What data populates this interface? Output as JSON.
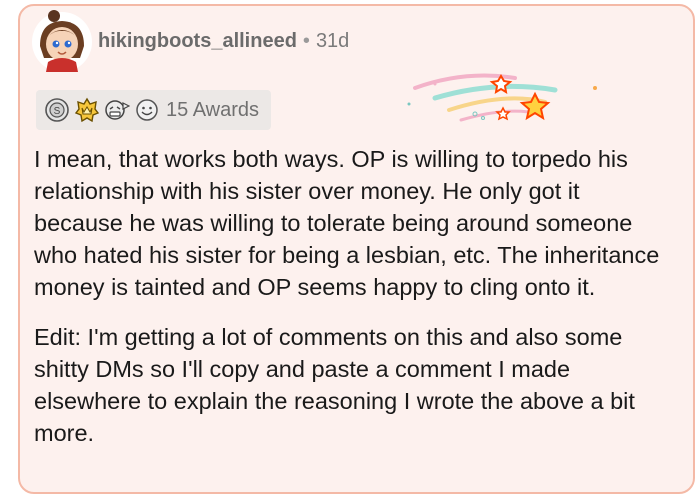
{
  "comment": {
    "username": "hikingboots_allineed",
    "separator": "•",
    "age": "31d",
    "awards": {
      "icons": [
        "silver-award-icon",
        "gold-crown-award-icon",
        "grimace-award-icon",
        "smile-award-icon"
      ],
      "label": "15 Awards"
    },
    "paragraphs": [
      "I mean, that works both ways. OP is willing to torpedo his relationship with his sister over money. He only got it because he was willing to tolerate being around someone who hated his sister for being a lesbian, etc. The inheritance money is tainted and OP seems happy to cling onto it.",
      "Edit: I'm getting a lot of comments on this and also some shitty DMs so I'll copy and paste a comment I made elsewhere to explain the reasoning I wrote the above a bit more."
    ]
  },
  "colors": {
    "card_background": "#fdf1ee",
    "card_border": "#f4b9a6",
    "star_accent": "#ff4500"
  }
}
